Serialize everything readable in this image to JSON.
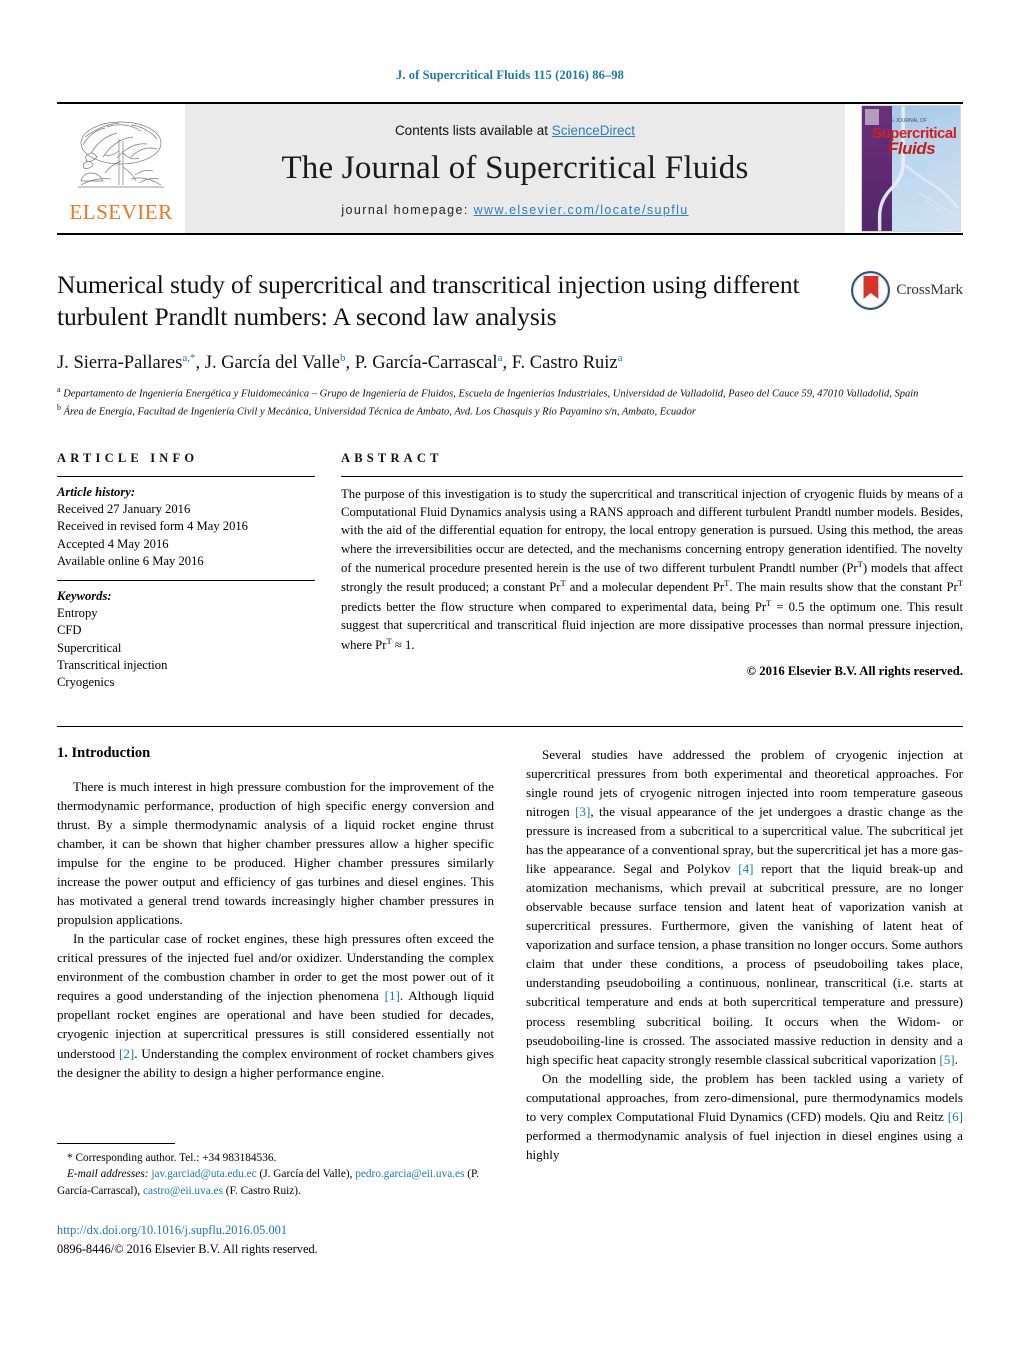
{
  "running_head": "J. of Supercritical Fluids 115 (2016) 86–98",
  "masthead": {
    "publisher_name": "ELSEVIER",
    "contents_prefix": "Contents lists available at ",
    "contents_link": "ScienceDirect",
    "journal_title": "The Journal of Supercritical Fluids",
    "homepage_label": "journal homepage:",
    "homepage_url": "www.elsevier.com/locate/supflu",
    "cover": {
      "the_journal_of": "THE JOURNAL OF",
      "supercritical": "Supercritical",
      "fluids": "Fluids"
    }
  },
  "article": {
    "title": "Numerical study of supercritical and transcritical injection using different turbulent Prandlt numbers: A second law analysis",
    "crossmark_label": "CrossMark",
    "authors_html": "J. Sierra-Pallares<sup class=\"star\">a,*</sup>, J. García del Valle<sup>b</sup>, P. García-Carrascal<sup>a</sup>, F. Castro Ruiz<sup>a</sup>",
    "affiliation_a": "Departamento de Ingeniería Energética y Fluidomecánica – Grupo de Ingeniería de Fluidos, Escuela de Ingenierías Industriales, Universidad de Valladolid, Paseo del Cauce 59, 47010 Valladolid, Spain",
    "affiliation_b": "Área de Energía, Facultad de Ingeniería Civil y Mecánica, Universidad Técnica de Ambato, Avd. Los Chasquis y Río Payamino s/n, Ambato, Ecuador"
  },
  "article_info": {
    "heading": "ARTICLE INFO",
    "history_label": "Article history:",
    "history": [
      "Received 27 January 2016",
      "Received in revised form 4 May 2016",
      "Accepted 4 May 2016",
      "Available online 6 May 2016"
    ],
    "keywords_label": "Keywords:",
    "keywords": [
      "Entropy",
      "CFD",
      "Supercritical",
      "Transcritical injection",
      "Cryogenics"
    ]
  },
  "abstract": {
    "heading": "ABSTRACT",
    "text_html": "The purpose of this investigation is to study the supercritical and transcritical injection of cryogenic fluids by means of a Computational Fluid Dynamics analysis using a RANS approach and different turbulent Prandtl number models. Besides, with the aid of the differential equation for entropy, the local entropy generation is pursued. Using this method, the areas where the irreversibilities occur are detected, and the mechanisms concerning entropy generation identified. The novelty of the numerical procedure presented herein is the use of two different turbulent Prandtl number (Pr<sup>T</sup>) models that affect strongly the result produced; a constant Pr<sup>T</sup> and a molecular dependent Pr<sup>T</sup>. The main results show that the constant Pr<sup>T</sup> predicts better the flow structure when compared to experimental data, being Pr<sup>T</sup> = 0.5 the optimum one. This result suggest that supercritical and transcritical fluid injection are more dissipative processes than normal pressure injection, where Pr<sup>T</sup> ≈ 1.",
    "copyright": "© 2016 Elsevier B.V. All rights reserved."
  },
  "body": {
    "section_heading": "1. Introduction",
    "left_paragraphs_html": [
      "There is much interest in high pressure combustion for the improvement of the thermodynamic performance, production of high specific energy conversion and thrust. By a simple thermodynamic analysis of a liquid rocket engine thrust chamber, it can be shown that higher chamber pressures allow a higher specific impulse for the engine to be produced. Higher chamber pressures similarly increase the power output and efficiency of gas turbines and diesel engines. This has motivated a general trend towards increasingly higher chamber pressures in propulsion applications.",
      "In the particular case of rocket engines, these high pressures often exceed the critical pressures of the injected fuel and/or oxidizer. Understanding the complex environment of the combustion chamber in order to get the most power out of it requires a good understanding of the injection phenomena <span class=\"ref\">[1]</span>. Although liquid propellant rocket engines are operational and have been studied for decades, cryogenic injection at supercritical pressures is still considered essentially not understood <span class=\"ref\">[2]</span>. Understanding the complex environment of rocket chambers gives the designer the ability to design a higher performance engine."
    ],
    "right_paragraphs_html": [
      "Several studies have addressed the problem of cryogenic injection at supercritical pressures from both experimental and theoretical approaches. For single round jets of cryogenic nitrogen injected into room temperature gaseous nitrogen <span class=\"ref\">[3]</span>, the visual appearance of the jet undergoes a drastic change as the pressure is increased from a subcritical to a supercritical value. The subcritical jet has the appearance of a conventional spray, but the supercritical jet has a more gas-like appearance. Segal and Polykov <span class=\"ref\">[4]</span> report that the liquid break-up and atomization mechanisms, which prevail at subcritical pressure, are no longer observable because surface tension and latent heat of vaporization vanish at supercritical pressures. Furthermore, given the vanishing of latent heat of vaporization and surface tension, a phase transition no longer occurs. Some authors claim that under these conditions, a process of pseudoboiling takes place, understanding pseudoboiling a continuous, nonlinear, transcritical (i.e. starts at subcritical temperature and ends at both supercritical temperature and pressure) process resembling subcritical boiling. It occurs when the Widom- or pseudoboiling-line is crossed. The associated massive reduction in density and a high specific heat capacity strongly resemble classical subcritical vaporization <span class=\"ref\">[5]</span>.",
      "On the modelling side, the problem has been tackled using a variety of computational approaches, from zero-dimensional, pure thermodynamics models to very complex Computational Fluid Dynamics (CFD) models. Qiu and Reitz <span class=\"ref\">[6]</span> performed a thermodynamic analysis of fuel injection in diesel engines using a highly"
    ]
  },
  "footnotes": {
    "corresponding_html": "* Corresponding author. Tel.: +34 983184536.",
    "emails_html": "<span class=\"it\">E-mail addresses:</span> <span class=\"link\">jav.garciad@uta.edu.ec</span> (J. García del Valle), <span class=\"link\">pedro.garcia@eii.uva.es</span> (P. García-Carrascal), <span class=\"link\">castro@eii.uva.es</span> (F. Castro Ruiz).",
    "doi": "http://dx.doi.org/10.1016/j.supflu.2016.05.001",
    "issn_line": "0896-8446/© 2016 Elsevier B.V. All rights reserved."
  }
}
